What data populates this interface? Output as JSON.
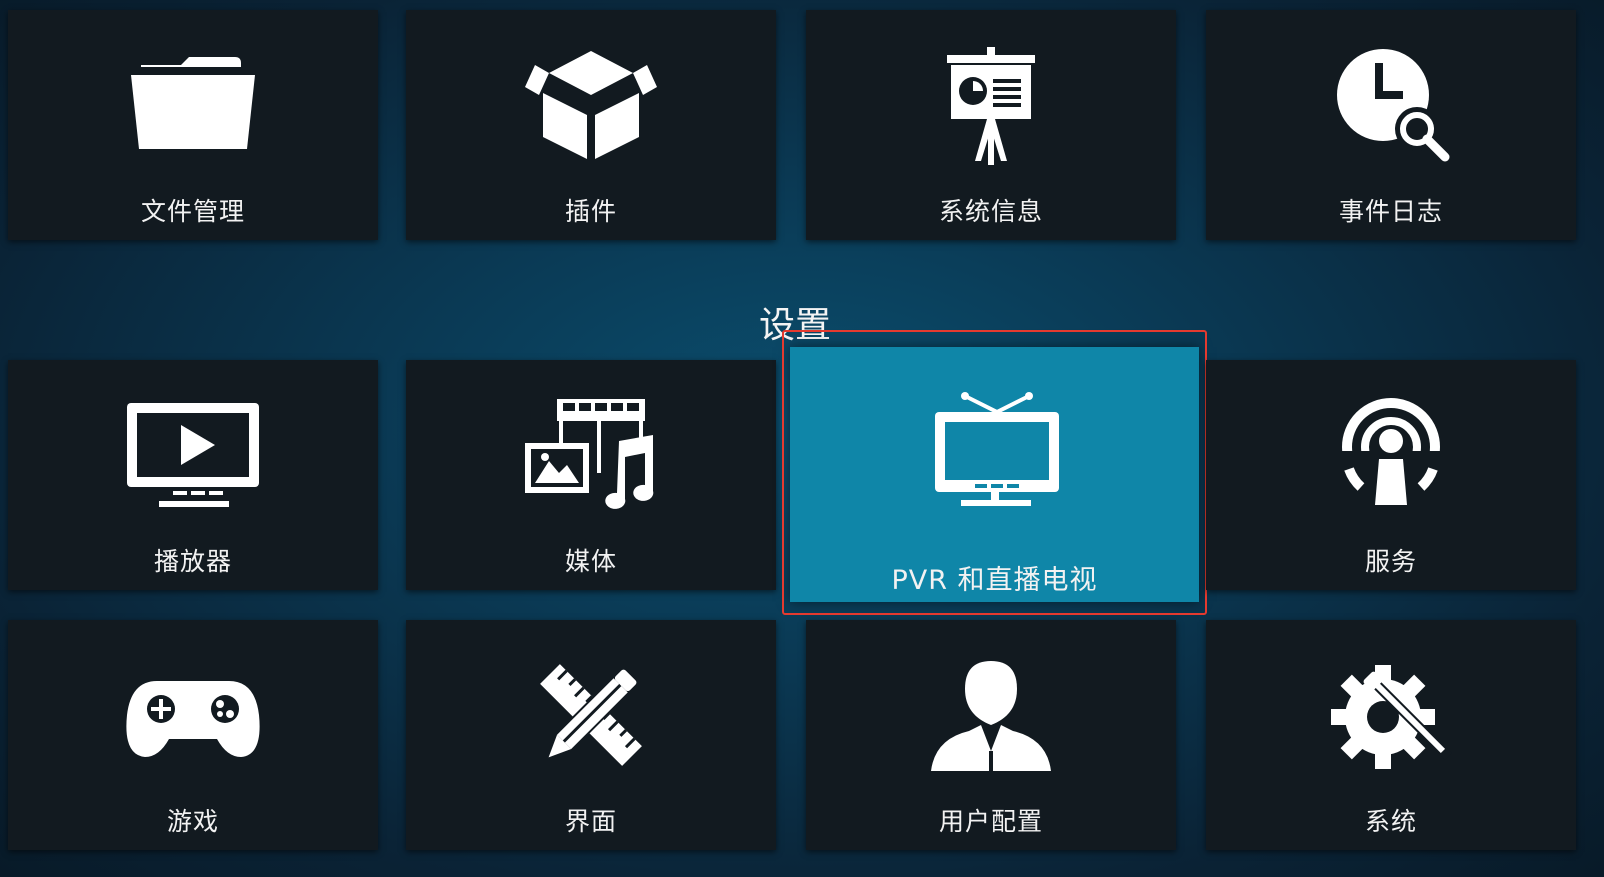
{
  "section_title": "设置",
  "top_row": [
    {
      "label": "文件管理",
      "icon": "folder-icon"
    },
    {
      "label": "插件",
      "icon": "addon-box-icon"
    },
    {
      "label": "系统信息",
      "icon": "presentation-icon"
    },
    {
      "label": "事件日志",
      "icon": "clock-search-icon"
    }
  ],
  "middle_row": [
    {
      "label": "播放器",
      "icon": "player-screen-icon"
    },
    {
      "label": "媒体",
      "icon": "media-icon"
    },
    {
      "label": "PVR 和直播电视",
      "icon": "tv-icon",
      "focused": true
    },
    {
      "label": "服务",
      "icon": "service-broadcast-icon"
    }
  ],
  "bottom_row": [
    {
      "label": "游戏",
      "icon": "gamepad-icon"
    },
    {
      "label": "界面",
      "icon": "pencil-ruler-icon"
    },
    {
      "label": "用户配置",
      "icon": "user-profile-icon"
    },
    {
      "label": "系统",
      "icon": "gear-wrench-icon"
    }
  ],
  "colors": {
    "tile_bg": "#121a20",
    "focus_bg": "#0f86a8",
    "focus_outline": "#e53a2f",
    "text": "#ffffff"
  }
}
